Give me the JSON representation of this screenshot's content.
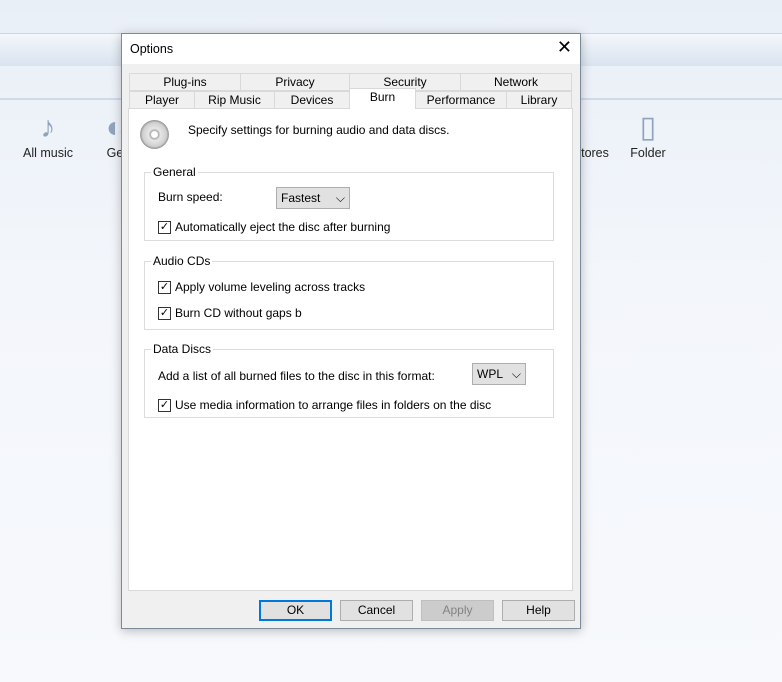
{
  "background": {
    "library_items": [
      {
        "label": "All music",
        "icon": "music-note-icon"
      },
      {
        "label": "Ge",
        "icon": "genre-icon"
      },
      {
        "label": "tores",
        "icon": "stores-icon"
      },
      {
        "label": "Folder",
        "icon": "folder-music-icon"
      }
    ]
  },
  "dialog": {
    "title": "Options",
    "tabs_row1": [
      "Plug-ins",
      "Privacy",
      "Security",
      "Network"
    ],
    "tabs_row2": [
      "Player",
      "Rip Music",
      "Devices",
      "Burn",
      "Performance",
      "Library"
    ],
    "active_tab": "Burn",
    "description": "Specify settings for burning audio and data discs.",
    "general": {
      "label": "General",
      "burn_speed_label": "Burn speed:",
      "burn_speed_value": "Fastest",
      "auto_eject": {
        "label": "Automatically eject the disc after burning",
        "checked": true
      }
    },
    "audio_cds": {
      "label": "Audio CDs",
      "volume_leveling": {
        "label": "Apply volume leveling across tracks",
        "checked": true
      },
      "no_gaps": {
        "label": "Burn CD without gaps b",
        "checked": true
      }
    },
    "data_discs": {
      "label": "Data Discs",
      "format_label": "Add a list of all burned files to the disc in this format:",
      "format_value": "WPL",
      "media_info": {
        "label": "Use media information to arrange files in folders on the disc",
        "checked": true
      }
    },
    "buttons": {
      "ok": "OK",
      "cancel": "Cancel",
      "apply": "Apply",
      "help": "Help"
    },
    "check_mark": "✓"
  }
}
